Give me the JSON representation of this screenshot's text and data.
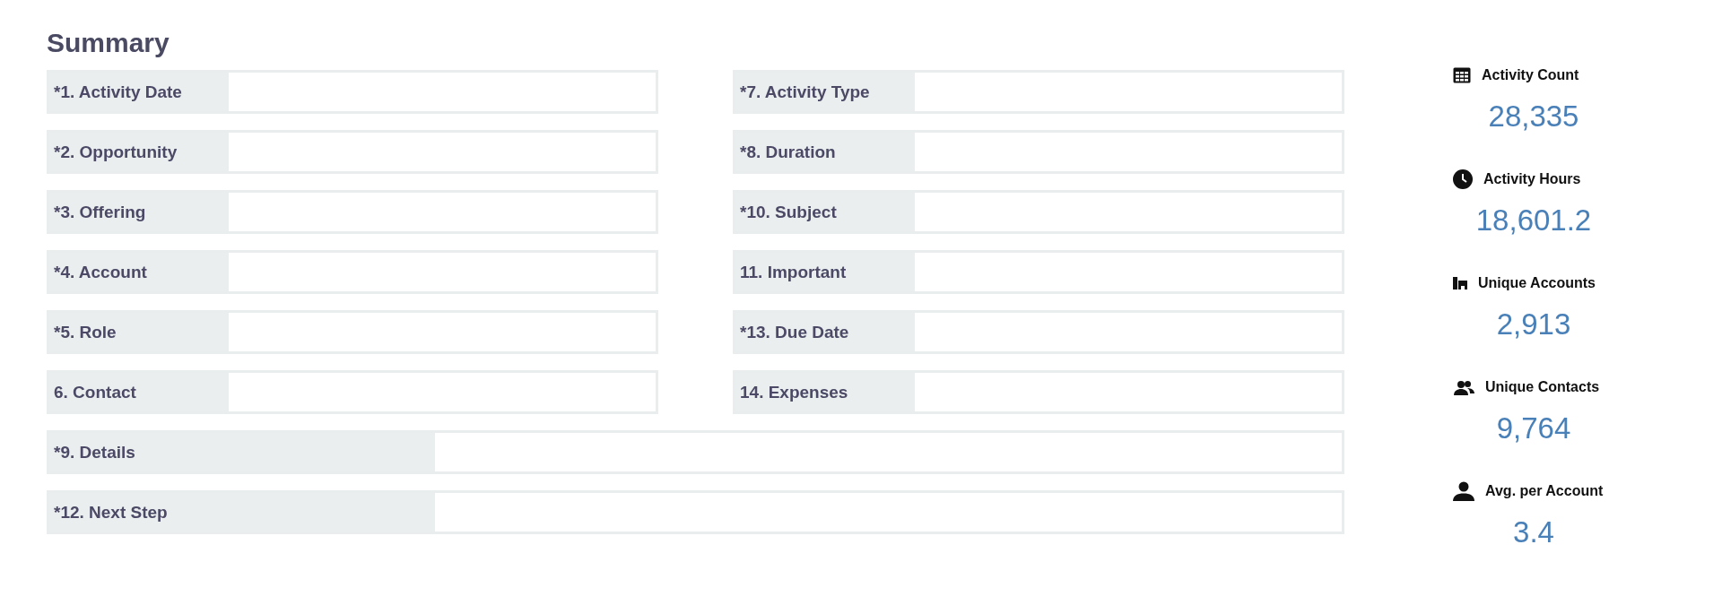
{
  "title": "Summary",
  "fields": [
    {
      "label": "*1. Activity Date",
      "kind": "half"
    },
    {
      "label": "*7. Activity Type",
      "kind": "half"
    },
    {
      "label": "*2. Opportunity",
      "kind": "half"
    },
    {
      "label": "*8. Duration",
      "kind": "half"
    },
    {
      "label": "*3. Offering",
      "kind": "half"
    },
    {
      "label": "*10. Subject",
      "kind": "half"
    },
    {
      "label": "*4. Account",
      "kind": "half"
    },
    {
      "label": "11. Important",
      "kind": "half"
    },
    {
      "label": "*5. Role",
      "kind": "half"
    },
    {
      "label": "*13. Due Date",
      "kind": "half"
    },
    {
      "label": "6. Contact",
      "kind": "half"
    },
    {
      "label": "14. Expenses",
      "kind": "half"
    },
    {
      "label": "*9. Details",
      "kind": "full"
    },
    {
      "label": "*12. Next Step",
      "kind": "full"
    }
  ],
  "stats": [
    {
      "label": "Activity Count",
      "value": "28,335"
    },
    {
      "label": "Activity Hours",
      "value": "18,601.2"
    },
    {
      "label": "Unique Accounts",
      "value": "2,913"
    },
    {
      "label": "Unique Contacts",
      "value": "9,764"
    },
    {
      "label": "Avg. per Account",
      "value": "3.4"
    }
  ]
}
